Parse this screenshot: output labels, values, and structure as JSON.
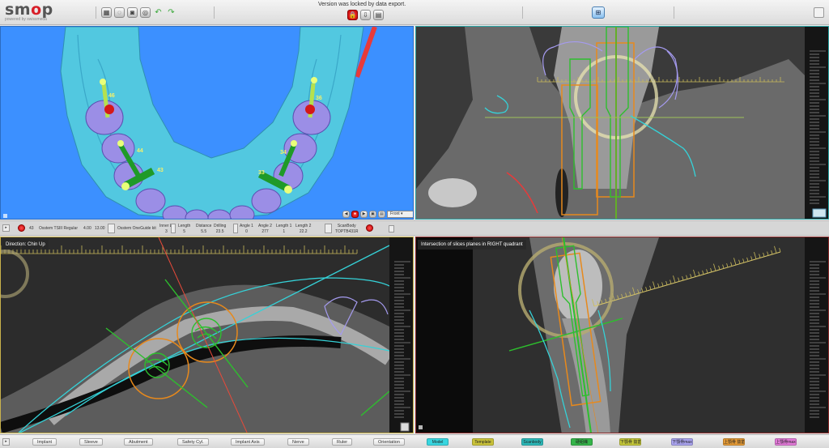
{
  "app": {
    "logo_text": "smop",
    "logo_sub": "powered by swissmeda",
    "version_message": "Version was locked by data export."
  },
  "viewports": {
    "pano_label": "Direction: Chin Up",
    "cs2_label": "Intersection of slices planes in RIGHT quadrant",
    "view_select": "Front"
  },
  "teeth": [
    {
      "number": "46"
    },
    {
      "number": "36"
    },
    {
      "number": "44"
    },
    {
      "number": "34"
    },
    {
      "number": "43"
    },
    {
      "number": "33"
    }
  ],
  "implant_info": {
    "tooth": "43",
    "implant_name": "Osstem TSIII Regular",
    "diameter": "4.00",
    "length": "13.00",
    "sleeve": "Osstem OneGuide kit",
    "fields": [
      {
        "label": "Inner Ø",
        "value": "3"
      },
      {
        "label": "Length",
        "value": "5"
      },
      {
        "label": "Distance",
        "value": "5.5"
      },
      {
        "label": "Drilling",
        "value": "23.5"
      },
      {
        "label": "Angle 1",
        "value": "0"
      },
      {
        "label": "Angle 2",
        "value": "277"
      },
      {
        "label": "Length 1",
        "value": "1"
      },
      {
        "label": "Length 2",
        "value": "22.2"
      }
    ],
    "scanbody_label": "ScanBody",
    "scanbody_value": "TOPTB431R"
  },
  "legend": {
    "left_buttons": [
      "Implant",
      "Sleeve",
      "Abutment",
      "Safety Cyl.",
      "Implant Axis",
      "Nerve",
      "Ruler",
      "Orientation"
    ],
    "colored_buttons": [
      {
        "label": "Model",
        "color": "#38d6e0"
      },
      {
        "label": "Template",
        "color": "#c9c23a"
      },
      {
        "label": "Scanbody",
        "color": "#2cb8b8"
      },
      {
        "label": "硬組織",
        "color": "#35b54a"
      },
      {
        "label": "下顎骨 抜歯",
        "color": "#c3c63a"
      },
      {
        "label": "下顎骨max",
        "color": "#a9a3ee"
      },
      {
        "label": "上顎骨 抜歯",
        "color": "#e49a36"
      },
      {
        "label": "上顎骨max",
        "color": "#e27ad8"
      }
    ]
  },
  "colors": {
    "gum": "#52c8e0",
    "tooth": "#9b8ee6",
    "implant": "#1f9a28",
    "scene_bg": "#3c90ff",
    "nerve": "#e83a3a"
  }
}
